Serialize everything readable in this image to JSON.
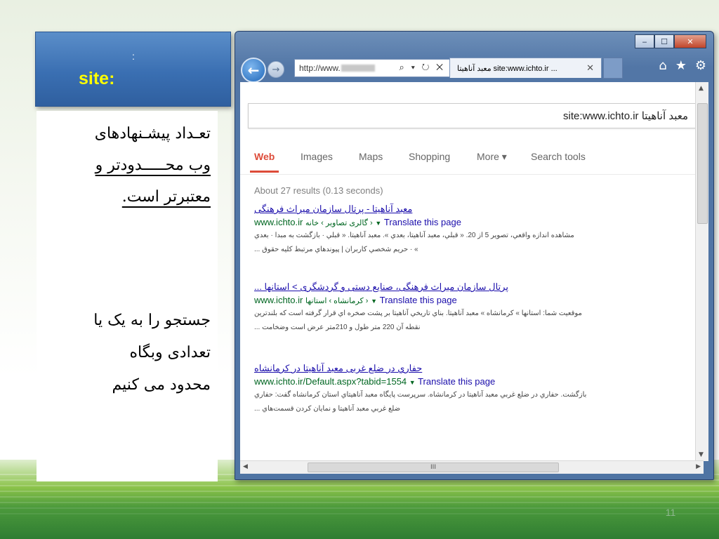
{
  "slide": {
    "title_colon": ":",
    "title": "site:",
    "text_lines": [
      "تعـداد پیشـنهادهای",
      "وب محـــــدودتر و",
      "معتبرتر است."
    ],
    "text2_lines": [
      "جستجو را به یک یا",
      "تعدادی وبگاه",
      "محدود می کنیم"
    ],
    "slide_number": "11",
    "colors": {
      "title_bg": "#3a6fb2",
      "title_text": "#ffff00",
      "band_dark": "#2f7d32",
      "band_light": "#8bc34a"
    }
  },
  "browser": {
    "address_text": "http://www.",
    "address_controls": "⌕ ▾ ↻ ✕",
    "tab_title": "معبد آناهيتا site:www.ichto.ir ...",
    "tab_close": "✕",
    "window_buttons": [
      "‒",
      "☐",
      "✕"
    ],
    "toolbar_icons": [
      "home-icon",
      "favorites-star-icon",
      "settings-gear-icon"
    ],
    "toolbar_glyphs": [
      "⌂",
      "★",
      "⚙"
    ],
    "hscroll_grip": "III"
  },
  "google": {
    "query": "site:www.ichto.ir معبد آناهیتا",
    "tabs": [
      "Web",
      "Images",
      "Maps",
      "Shopping",
      "More ▾",
      "Search tools"
    ],
    "stats": "About 27 results (0.13 seconds)",
    "results": [
      {
        "title": "معبد آناهیتا - پرتال سازمان میراث فرهنگی",
        "url": "www.ichto.ir",
        "crumb": "گالری تصاویر › خانه ›",
        "translate": "Translate this page",
        "snippet1": "مشاهده اندازه واقعي، تصوير 5 از 20. « قبلي، معبد آناهيتا، بعدي ». معبد آناهيتا. « قبلي · بازگشت به مبدا · بعدي",
        "snippet2": "» · حريم شخصي كاربران | پيوندهاي مرتبط كليه حقوق ..."
      },
      {
        "title": "پرتال سازمان میراث فرهنگی، صنایع دستی و گردشگری > استانها ...",
        "url": "www.ichto.ir",
        "crumb": "كرمانشاه › استانها ›",
        "translate": "Translate this page",
        "snippet1": "موقعيت شما: استانها » كرمانشاه » معبد آناهيتا. بناي تاريخي آناهيتا بر پشت صخره اي قرار گرفته است كه بلندترين",
        "snippet2": "نقطه آن 220 متر طول و 210متر عرض است وضخامت ..."
      },
      {
        "title": "حفاري در ضلع غربی معبد آناهیتا در کرمانشاه",
        "url": "www.ichto.ir/Default.aspx?tabid=1554",
        "crumb": "",
        "translate": "Translate this page",
        "snippet1": "بازگشت. حفاري در ضلع غربي معبد آناهيتا در كرمانشاه. سرپرست پايگاه معبد آناهيتاي استان كرمانشاه گفت: حفاري",
        "snippet2": "ضلع غربي معبد آناهيتا و نمايان كردن قسمت‌هاي ..."
      }
    ]
  }
}
